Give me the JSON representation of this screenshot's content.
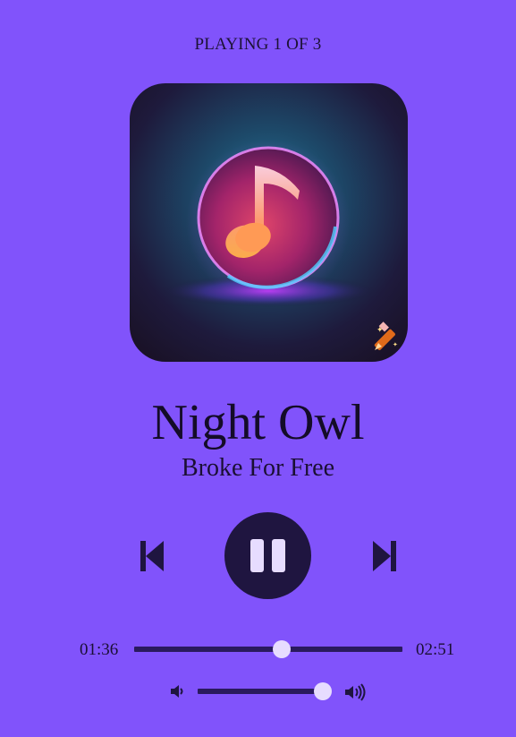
{
  "status": {
    "text": "PLAYING 1 OF 3",
    "current_index": 1,
    "total": 3
  },
  "track": {
    "title": "Night Owl",
    "artist": "Broke For Free",
    "artwork_icon": "music-note-icon",
    "artwork_badge_icon": "pencil-edit-icon"
  },
  "controls": {
    "prev_icon": "skip-previous-icon",
    "play_state_icon": "pause-icon",
    "next_icon": "skip-next-icon"
  },
  "progress": {
    "current_time": "01:36",
    "duration": "02:51",
    "fraction": 0.55
  },
  "volume": {
    "low_icon": "volume-low-icon",
    "high_icon": "volume-high-icon",
    "fraction": 0.94
  },
  "colors": {
    "background": "#8153fb",
    "controls": "#1f1540",
    "track": "#2a1a5e",
    "knob": "#e7dcff"
  }
}
